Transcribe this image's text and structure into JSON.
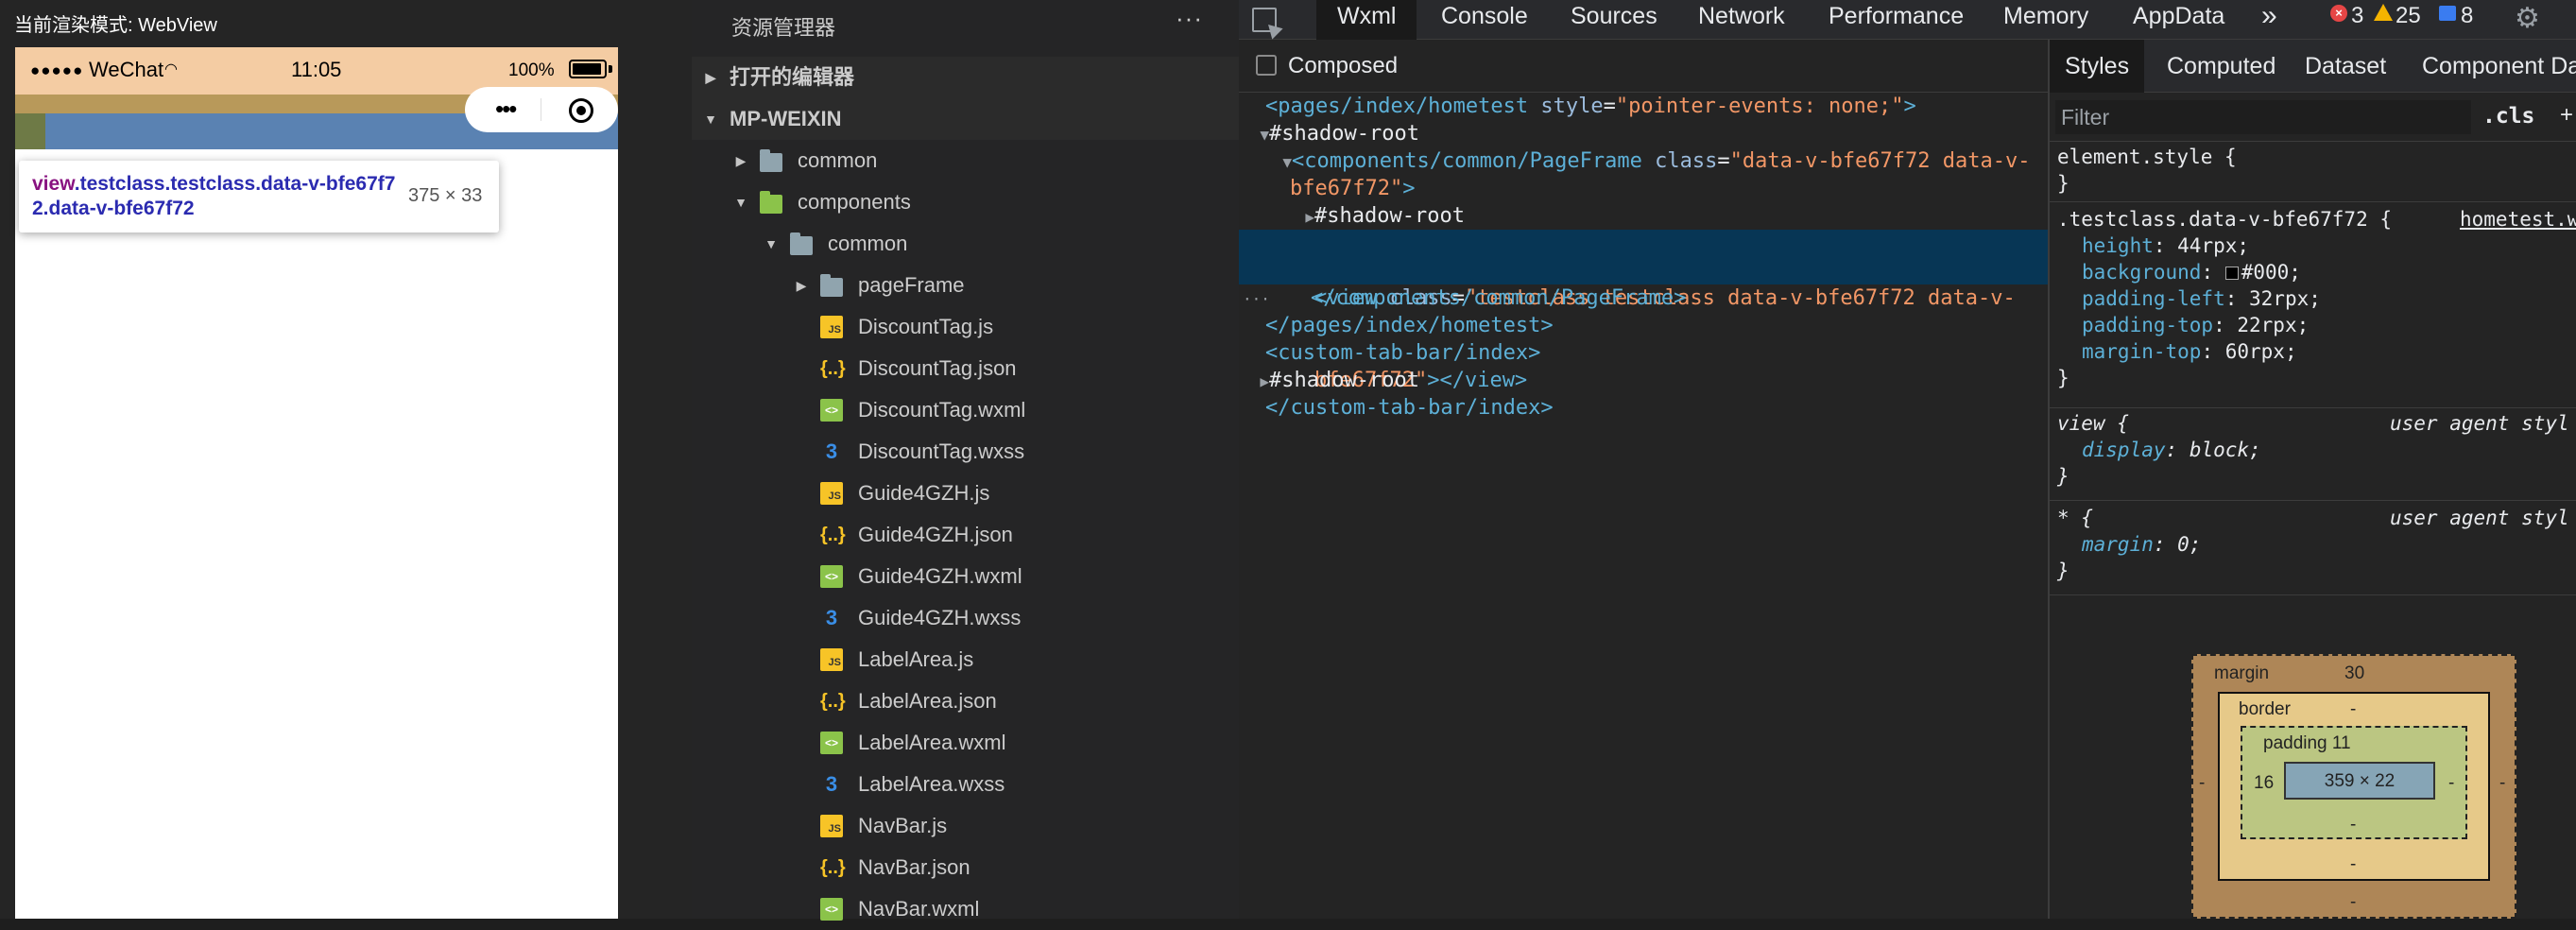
{
  "simulator": {
    "render_mode_label": "当前渲染模式: WebView",
    "status": {
      "carrier": "WeChat",
      "time": "11:05",
      "battery": "100%"
    },
    "tooltip": {
      "tag": "view",
      "selector": ".testclass.testclass.data-v-bfe67f72.data-v-bfe67f72",
      "size": "375 × 33"
    }
  },
  "explorer": {
    "title": "资源管理器",
    "more": "···",
    "open_editors": "打开的编辑器",
    "project": "MP-WEIXIN",
    "folders": {
      "common": "common",
      "components": "components",
      "components_common": "common",
      "pageFrame": "pageFrame"
    },
    "files": [
      {
        "name": "DiscountTag.js",
        "type": "js"
      },
      {
        "name": "DiscountTag.json",
        "type": "json"
      },
      {
        "name": "DiscountTag.wxml",
        "type": "wxml"
      },
      {
        "name": "DiscountTag.wxss",
        "type": "wxss"
      },
      {
        "name": "Guide4GZH.js",
        "type": "js"
      },
      {
        "name": "Guide4GZH.json",
        "type": "json"
      },
      {
        "name": "Guide4GZH.wxml",
        "type": "wxml"
      },
      {
        "name": "Guide4GZH.wxss",
        "type": "wxss"
      },
      {
        "name": "LabelArea.js",
        "type": "js"
      },
      {
        "name": "LabelArea.json",
        "type": "json"
      },
      {
        "name": "LabelArea.wxml",
        "type": "wxml"
      },
      {
        "name": "LabelArea.wxss",
        "type": "wxss"
      },
      {
        "name": "NavBar.js",
        "type": "js"
      },
      {
        "name": "NavBar.json",
        "type": "json"
      },
      {
        "name": "NavBar.wxml",
        "type": "wxml"
      }
    ]
  },
  "devtools": {
    "tabs": [
      "Wxml",
      "Console",
      "Sources",
      "Network",
      "Performance",
      "Memory",
      "AppData"
    ],
    "more": "»",
    "errors": "3",
    "warnings": "25",
    "infos": "8",
    "composed": "Composed",
    "dom": {
      "l1_tag": "<pages/index/hometest",
      "l1_attr": "style",
      "l1_val": "\"pointer-events: none;\"",
      "l1_end": ">",
      "shadow_root": "#shadow-root",
      "l3_tag": "<components/common/PageFrame",
      "l3_attr": "class",
      "l3_val_a": "\"data-v-bfe67f72 data-v-",
      "l3_val_b": "bfe67f72\"",
      "l5_tag": "<view",
      "l5_attr": "class",
      "l5_val_a": "\"testclass testclass data-v-bfe67f72 data-v-",
      "l5_val_b": "bfe67f72\"",
      "l5_close": "></view>",
      "l7": "</components/common/PageFrame>",
      "l8": "</pages/index/hometest>",
      "l9": "<custom-tab-bar/index>",
      "l11": "</custom-tab-bar/index>"
    },
    "styles_tabs": [
      "Styles",
      "Computed",
      "Dataset",
      "Component Da"
    ],
    "filter_placeholder": "Filter",
    "cls": ".cls",
    "rules": {
      "element_style": "element.style {",
      "close": "}",
      "testclass_selector": ".testclass.data-v-bfe67f72 {",
      "testclass_source": "hometest.w",
      "props": [
        {
          "name": "height",
          "value": "44rpx;"
        },
        {
          "name": "background",
          "value": "#000;"
        },
        {
          "name": "padding-left",
          "value": "32rpx;"
        },
        {
          "name": "padding-top",
          "value": "22rpx;"
        },
        {
          "name": "margin-top",
          "value": "60rpx;"
        }
      ],
      "view_selector": "view {",
      "view_prop": "display",
      "view_value": "block;",
      "star_selector": "* {",
      "star_prop": "margin",
      "star_value": "0;",
      "ua": "user agent styl"
    },
    "box_model": {
      "margin_label": "margin",
      "margin_top": "30",
      "margin_side": "-",
      "border_label": "border",
      "border_val": "-",
      "padding_label": "padding 11",
      "padding_left": "16",
      "padding_other": "-",
      "content": "359 × 22"
    }
  }
}
